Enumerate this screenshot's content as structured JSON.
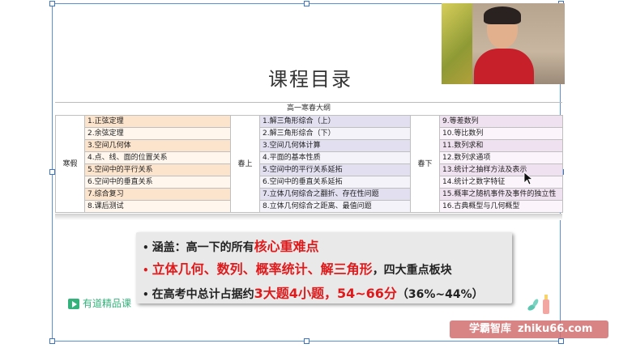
{
  "slide": {
    "title": "课程目录",
    "outline_title": "高一寒春大纲",
    "seasons": {
      "winter": "寒假",
      "spring_a": "春上",
      "spring_b": "春下"
    },
    "winter_items": [
      "1.正弦定理",
      "2.余弦定理",
      "3.空间几何体",
      "4.点、线、面的位置关系",
      "5.空间中的平行关系",
      "6.空间中的垂直关系",
      "7.综合复习",
      "8.课后测试"
    ],
    "spring_a_items": [
      "1.解三角形综合（上）",
      "2.解三角形综合（下）",
      "3.空间几何体计算",
      "4.平面的基本性质",
      "5.空间中的平行关系延拓",
      "6.空间中的垂直关系延拓",
      "7.立体几何综合之翻折、存在性问题",
      "8.立体几何综合之距离、最值问题"
    ],
    "spring_b_items": [
      "9.等差数列",
      "10.等比数列",
      "11.数列求和",
      "12.数列求通项",
      "13.统计之抽样方法及表示",
      "14.统计之数字特征",
      "15.概率之随机事件及事件的独立性",
      "16.古典概型与几何概型"
    ],
    "summary": {
      "b1_prefix": "涵盖：高一下的所有",
      "b1_highlight": "核心重难点",
      "b2_highlight": "立体几何、数列、概率统计、解三角形",
      "b2_suffix": "，四大重点板块",
      "b3_prefix": "在高考中总计占据约",
      "b3_highlight": "3大题4小题，54~66分",
      "b3_suffix": "（36%~44%）",
      "bullet": "•"
    },
    "logo_text": "有道精品课"
  },
  "watermark": {
    "cn": "学霸智库",
    "url": "zhiku66.com"
  },
  "colors": {
    "red": "#e0191b",
    "frame": "#5b8fd6"
  }
}
